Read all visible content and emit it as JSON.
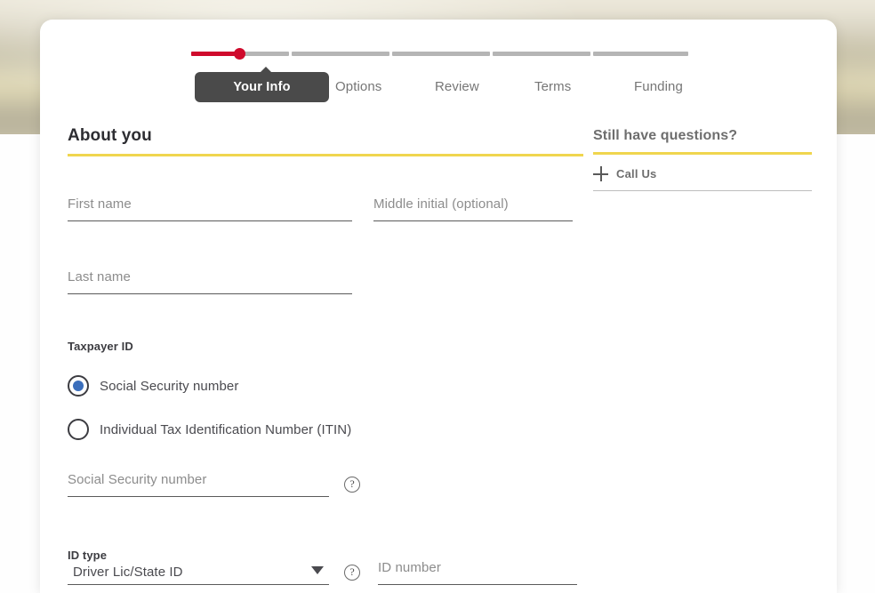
{
  "stepper": {
    "steps": [
      {
        "label": "Your Info",
        "state": "current"
      },
      {
        "label": "Options",
        "state": "upcoming"
      },
      {
        "label": "Review",
        "state": "upcoming"
      },
      {
        "label": "Terms",
        "state": "upcoming"
      },
      {
        "label": "Funding",
        "state": "upcoming"
      }
    ],
    "progress_percent": 10,
    "colors": {
      "fill": "#cf0a2c",
      "track": "#b5b5b5",
      "tooltip_bg": "#4a4a4a"
    }
  },
  "main": {
    "section_title": "About you",
    "accent_color": "#f0d64e",
    "fields": {
      "first_name": {
        "placeholder": "First name",
        "value": ""
      },
      "middle_initial": {
        "placeholder": "Middle initial (optional)",
        "value": ""
      },
      "last_name": {
        "placeholder": "Last name",
        "value": ""
      },
      "ssn": {
        "placeholder": "Social Security number",
        "value": ""
      },
      "id_number": {
        "placeholder": "ID number",
        "value": ""
      }
    },
    "taxpayer": {
      "label": "Taxpayer ID",
      "options": [
        {
          "label": "Social Security number",
          "selected": true
        },
        {
          "label": "Individual Tax Identification Number (ITIN)",
          "selected": false
        }
      ],
      "selected_color": "#3a6ebc"
    },
    "id_type": {
      "label": "ID type",
      "value": "Driver Lic/State ID"
    },
    "help_glyph": "?"
  },
  "aside": {
    "title": "Still have questions?",
    "items": [
      {
        "label": "Call Us",
        "icon": "plus-icon"
      }
    ]
  }
}
